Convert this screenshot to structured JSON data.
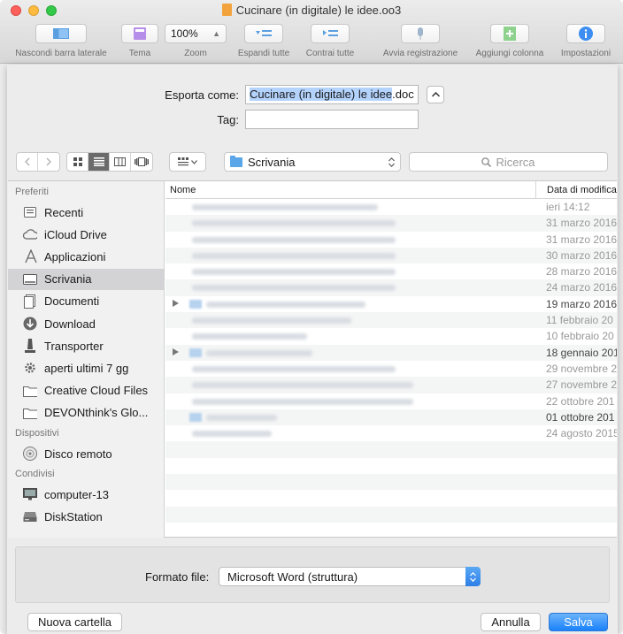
{
  "window": {
    "title": "Cucinare (in digitale) le idee.oo3"
  },
  "toolbar": {
    "items": [
      {
        "label": "Nascondi barra laterale"
      },
      {
        "label": "Tema"
      },
      {
        "label": "Zoom",
        "value": "100%"
      },
      {
        "label": "Espandi tutte"
      },
      {
        "label": "Contrai tutte"
      },
      {
        "label": "Avvia registrazione"
      },
      {
        "label": "Aggiungi colonna"
      },
      {
        "label": "Impostazioni"
      }
    ]
  },
  "save_dialog": {
    "export_label": "Esporta come:",
    "filename_selected": "Cucinare (in digitale) le idee",
    "filename_ext": ".doc",
    "tags_label": "Tag:",
    "tags_value": "",
    "location": "Scrivania",
    "search_placeholder": "Ricerca"
  },
  "sidebar": {
    "sections": [
      {
        "title": "Preferiti",
        "items": [
          {
            "label": "Recenti",
            "icon": "recents-icon"
          },
          {
            "label": "iCloud Drive",
            "icon": "cloud-icon"
          },
          {
            "label": "Applicazioni",
            "icon": "applications-icon"
          },
          {
            "label": "Scrivania",
            "icon": "desktop-icon",
            "selected": true
          },
          {
            "label": "Documenti",
            "icon": "documents-icon"
          },
          {
            "label": "Download",
            "icon": "download-icon"
          },
          {
            "label": "Transporter",
            "icon": "transporter-icon"
          },
          {
            "label": "aperti ultimi 7 gg",
            "icon": "gear-icon"
          },
          {
            "label": "Creative Cloud Files",
            "icon": "folder-icon"
          },
          {
            "label": "DEVONthink's Glo...",
            "icon": "folder-icon"
          }
        ]
      },
      {
        "title": "Dispositivi",
        "items": [
          {
            "label": "Disco remoto",
            "icon": "disc-icon"
          }
        ]
      },
      {
        "title": "Condivisi",
        "items": [
          {
            "label": "computer-13",
            "icon": "monitor-icon"
          },
          {
            "label": "DiskStation",
            "icon": "server-icon"
          }
        ]
      }
    ]
  },
  "file_list": {
    "columns": [
      "Nome",
      "Data di modifica"
    ],
    "rows": [
      {
        "date": "ieri 14:12",
        "folder": false,
        "expandable": false
      },
      {
        "date": "31 marzo 2016",
        "folder": false,
        "expandable": false
      },
      {
        "date": "31 marzo 2016",
        "folder": false,
        "expandable": false
      },
      {
        "date": "30 marzo 2016",
        "folder": false,
        "expandable": false
      },
      {
        "date": "28 marzo 2016",
        "folder": false,
        "expandable": false
      },
      {
        "date": "24 marzo 2016",
        "folder": false,
        "expandable": false
      },
      {
        "date": "19 marzo 2016",
        "folder": true,
        "expandable": true
      },
      {
        "date": "11 febbraio 20",
        "folder": false,
        "expandable": false
      },
      {
        "date": "10 febbraio 20",
        "folder": false,
        "expandable": false
      },
      {
        "date": "18 gennaio 201",
        "folder": true,
        "expandable": true
      },
      {
        "date": "29 novembre 2",
        "folder": false,
        "expandable": false
      },
      {
        "date": "27 novembre 2",
        "folder": false,
        "expandable": false
      },
      {
        "date": "22 ottobre 201",
        "folder": false,
        "expandable": false
      },
      {
        "date": "01 ottobre 201",
        "folder": true,
        "expandable": false
      },
      {
        "date": "24 agosto 2015",
        "folder": false,
        "expandable": false
      }
    ]
  },
  "format": {
    "label": "Formato file:",
    "value": "Microsoft Word (struttura)"
  },
  "buttons": {
    "new_folder": "Nuova cartella",
    "cancel": "Annulla",
    "save": "Salva"
  },
  "colors": {
    "accent": "#1a82fb",
    "selection": "#b3d3fd",
    "sidebar_selection": "#d3d3d6"
  }
}
